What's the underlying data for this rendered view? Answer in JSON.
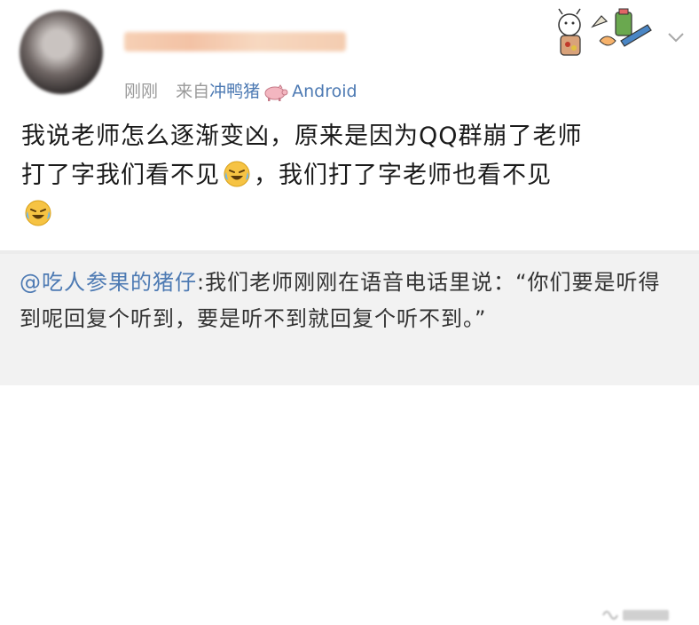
{
  "post": {
    "timestamp": "刚刚",
    "source_prefix": "来自",
    "source_name": "冲鸭猪",
    "platform": "Android",
    "content": {
      "line1": "我说老师怎么逐渐变凶，原来是因为QQ群崩了老师",
      "line2a": "打了字我们看不见",
      "line2b": "，我们打了字老师也看不见",
      "emoji": "laughing-crying-emoji"
    }
  },
  "comment": {
    "mention": "@吃人参果的猪仔",
    "text": ":我们老师刚刚在语音电话里说：“你们要是听得到呢回复个听到，要是听不到就回复个听不到。”"
  },
  "colors": {
    "link_blue": "#4d7ab3",
    "meta_gray": "#9a9a9a",
    "comment_bg": "#f2f2f2"
  }
}
